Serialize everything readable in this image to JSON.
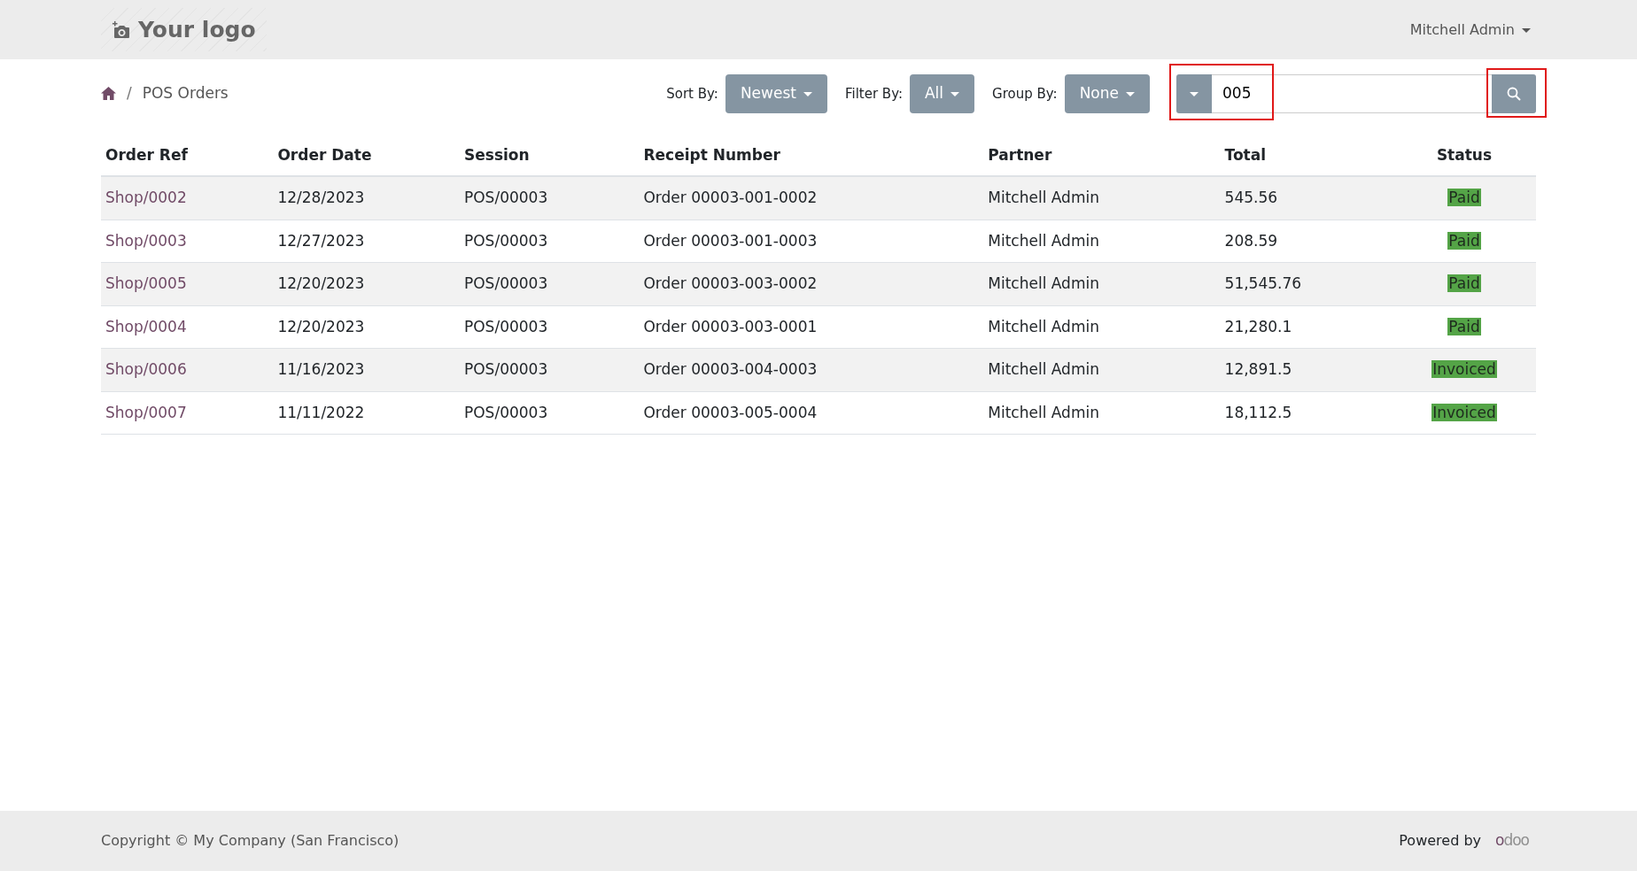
{
  "header": {
    "logo_text": "Your logo",
    "user_menu": "Mitchell Admin"
  },
  "breadcrumb": {
    "separator": "/",
    "current": "POS Orders"
  },
  "toolbar": {
    "sort": {
      "label": "Sort By:",
      "value": "Newest"
    },
    "filter": {
      "label": "Filter By:",
      "value": "All"
    },
    "group": {
      "label": "Group By:",
      "value": "None"
    }
  },
  "search": {
    "value": "005",
    "highlighted": true,
    "button_highlighted": true
  },
  "table": {
    "columns": [
      "Order Ref",
      "Order Date",
      "Session",
      "Receipt Number",
      "Partner",
      "Total",
      "Status"
    ],
    "rows": [
      {
        "ref": "Shop/0002",
        "date": "12/28/2023",
        "session": "POS/00003",
        "receipt": "Order 00003-001-0002",
        "partner": "Mitchell Admin",
        "total": "545.56",
        "status": "Paid"
      },
      {
        "ref": "Shop/0003",
        "date": "12/27/2023",
        "session": "POS/00003",
        "receipt": "Order 00003-001-0003",
        "partner": "Mitchell Admin",
        "total": "208.59",
        "status": "Paid"
      },
      {
        "ref": "Shop/0005",
        "date": "12/20/2023",
        "session": "POS/00003",
        "receipt": "Order 00003-003-0002",
        "partner": "Mitchell Admin",
        "total": "51,545.76",
        "status": "Paid"
      },
      {
        "ref": "Shop/0004",
        "date": "12/20/2023",
        "session": "POS/00003",
        "receipt": "Order 00003-003-0001",
        "partner": "Mitchell Admin",
        "total": "21,280.1",
        "status": "Paid"
      },
      {
        "ref": "Shop/0006",
        "date": "11/16/2023",
        "session": "POS/00003",
        "receipt": "Order 00003-004-0003",
        "partner": "Mitchell Admin",
        "total": "12,891.5",
        "status": "Invoiced"
      },
      {
        "ref": "Shop/0007",
        "date": "11/11/2022",
        "session": "POS/00003",
        "receipt": "Order 00003-005-0004",
        "partner": "Mitchell Admin",
        "total": "18,112.5",
        "status": "Invoiced"
      }
    ]
  },
  "footer": {
    "copyright": "Copyright © My Company (San Francisco)",
    "powered_by": "Powered by",
    "brand": "odoo"
  }
}
